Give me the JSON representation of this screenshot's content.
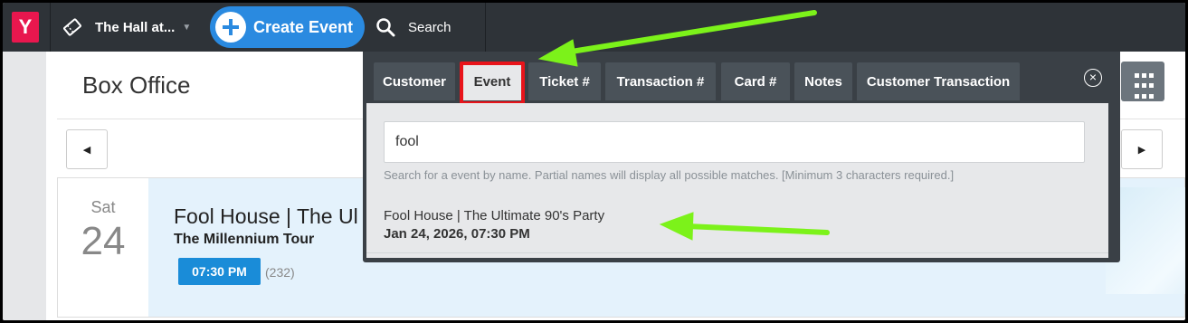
{
  "app": {
    "logo_letter": "Y",
    "venue": "The Hall at...",
    "create_label": "Create Event",
    "search_label": "Search"
  },
  "page": {
    "title": "Box Office"
  },
  "colors": {
    "accent": "#2a8ae0",
    "brand": "#e8174e",
    "highlight_box": "#e8141b",
    "annotation_arrow": "#7cf21a"
  },
  "event": {
    "day": "Sat",
    "date": "24",
    "title": "Fool House | The Ul",
    "subtitle": "The Millennium Tour",
    "time": "07:30 PM",
    "count": "(232)"
  },
  "search_overlay": {
    "tabs": [
      {
        "label": "Customer",
        "active": false
      },
      {
        "label": "Event",
        "active": true
      },
      {
        "label": "Ticket #",
        "active": false
      },
      {
        "label": "Transaction #",
        "active": false
      },
      {
        "label": "Card #",
        "active": false
      },
      {
        "label": "Notes",
        "active": false
      },
      {
        "label": "Customer Transaction",
        "active": false
      }
    ],
    "input_value": "fool",
    "help_text": "Search for a event by name. Partial names will display all possible matches. [Minimum 3 characters required.]",
    "results": [
      {
        "name": "Fool House | The Ultimate 90's Party",
        "date": "Jan 24, 2026, 07:30 PM"
      }
    ]
  },
  "icons": [
    "ticket-icon",
    "plus-icon",
    "search-icon",
    "close-icon",
    "grid-icon",
    "chevron-left-icon",
    "chevron-right-icon"
  ]
}
